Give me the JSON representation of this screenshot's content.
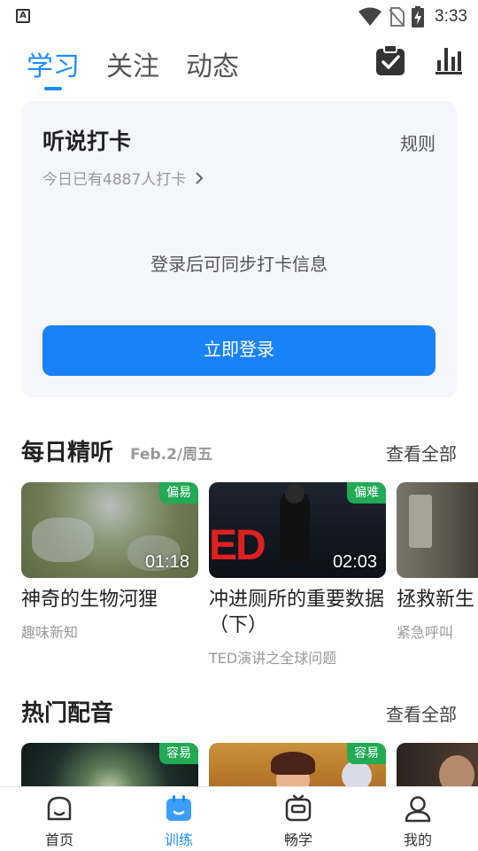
{
  "status_bar": {
    "time": "3:33",
    "notification": "A"
  },
  "top_tabs": [
    {
      "label": "学习",
      "active": true
    },
    {
      "label": "关注",
      "active": false
    },
    {
      "label": "动态",
      "active": false
    }
  ],
  "header_icons": [
    "clipboard-check-icon",
    "stats-bars-icon"
  ],
  "checkin": {
    "title": "听说打卡",
    "rule_label": "规则",
    "count_text": "今日已有4887人打卡",
    "message": "登录后可同步打卡信息",
    "login_button": "立即登录"
  },
  "daily_listening": {
    "title": "每日精听",
    "date": "Feb.2/周五",
    "see_all": "查看全部",
    "items": [
      {
        "badge": "偏易",
        "duration": "01:18",
        "title": "神奇的生物河狸",
        "subtitle": "趣味新知"
      },
      {
        "badge": "偏难",
        "duration": "02:03",
        "title": "冲进厕所的重要数据（下）",
        "subtitle": "TED演讲之全球问题"
      },
      {
        "badge": "",
        "duration": "",
        "title": "拯救新生",
        "subtitle": "紧急呼叫"
      }
    ]
  },
  "hot_dubbing": {
    "title": "热门配音",
    "see_all": "查看全部",
    "items": [
      {
        "badge": "容易"
      },
      {
        "badge": "容易"
      },
      {
        "badge": ""
      }
    ]
  },
  "bottom_nav": [
    {
      "label": "首页",
      "icon": "home-icon",
      "active": false
    },
    {
      "label": "训练",
      "icon": "training-icon",
      "active": true
    },
    {
      "label": "畅学",
      "icon": "tv-icon",
      "active": false
    },
    {
      "label": "我的",
      "icon": "profile-icon",
      "active": false
    }
  ],
  "colors": {
    "accent": "#1a8cff",
    "button": "#1a82f7",
    "badge_green": "#22aa55",
    "card_bg": "#f4f6fa"
  }
}
